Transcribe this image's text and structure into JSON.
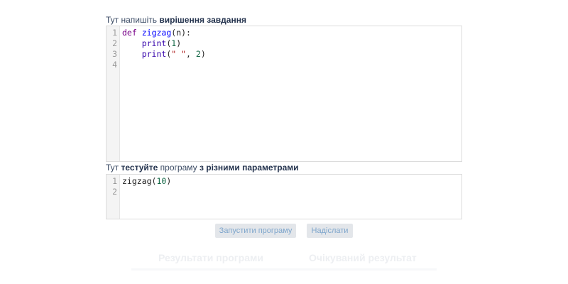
{
  "solution_label": {
    "prefix": "Тут напишіть ",
    "bold": "вирішення завдання"
  },
  "test_label": {
    "part1": "Тут ",
    "bold1": "тестуйте",
    "part2": " програму ",
    "bold2": "з різними параметрами"
  },
  "solution_editor": {
    "line_numbers": [
      "1",
      "2",
      "3",
      "4"
    ],
    "lines": [
      [
        {
          "t": "def",
          "c": "kw"
        },
        {
          "t": " ",
          "c": "plain"
        },
        {
          "t": "zigzag",
          "c": "def"
        },
        {
          "t": "(n):",
          "c": "plain"
        }
      ],
      [
        {
          "t": "    ",
          "c": "plain"
        },
        {
          "t": "print",
          "c": "builtin"
        },
        {
          "t": "(",
          "c": "plain"
        },
        {
          "t": "1",
          "c": "num"
        },
        {
          "t": ")",
          "c": "plain"
        }
      ],
      [
        {
          "t": "    ",
          "c": "plain"
        },
        {
          "t": "print",
          "c": "builtin"
        },
        {
          "t": "(",
          "c": "plain"
        },
        {
          "t": "\" \"",
          "c": "str"
        },
        {
          "t": ", ",
          "c": "plain"
        },
        {
          "t": "2",
          "c": "num"
        },
        {
          "t": ")",
          "c": "plain"
        }
      ],
      []
    ]
  },
  "test_editor": {
    "line_numbers": [
      "1",
      "2"
    ],
    "lines": [
      [
        {
          "t": "zigzag",
          "c": "plain"
        },
        {
          "t": "(",
          "c": "plain"
        },
        {
          "t": "10",
          "c": "num"
        },
        {
          "t": ")",
          "c": "plain"
        }
      ],
      []
    ]
  },
  "buttons": {
    "run": "Запустити програму",
    "submit": "Надіслати"
  },
  "results": {
    "output_heading": "Результати програми",
    "expected_heading": "Очікуваний результат"
  },
  "colors": {
    "keyword": "#770088",
    "function_name": "#0000ff",
    "builtin": "#3300aa",
    "number": "#116644",
    "string": "#aa1111",
    "button_bg": "#e3e6ea",
    "button_text": "#7ea6cc"
  }
}
